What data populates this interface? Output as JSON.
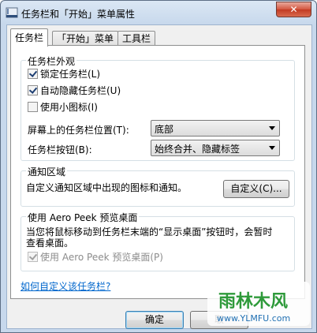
{
  "window": {
    "title": "任务栏和「开始」菜单属性",
    "close_label": "✕"
  },
  "tabs": [
    {
      "label": "任务栏",
      "active": true
    },
    {
      "label": "「开始」菜单",
      "active": false
    },
    {
      "label": "工具栏",
      "active": false
    }
  ],
  "appearance": {
    "title": "任务栏外观",
    "lock_taskbar": {
      "label": "锁定任务栏(L)",
      "checked": true
    },
    "auto_hide": {
      "label": "自动隐藏任务栏(U)",
      "checked": true
    },
    "small_icons": {
      "label": "使用小图标(I)",
      "checked": false
    },
    "location": {
      "label": "屏幕上的任务栏位置(T):",
      "value": "底部"
    },
    "buttons": {
      "label": "任务栏按钮(B):",
      "value": "始终合并、隐藏标签"
    }
  },
  "notification": {
    "title": "通知区域",
    "description": "自定义通知区域中出现的图标和通知。",
    "customize_label": "自定义(C)..."
  },
  "aero_peek": {
    "title": "使用 Aero Peek 预览桌面",
    "description_line1": "当您将鼠标移动到任务栏末端的“显示桌面”按钮时，会暂时",
    "description_line2": "查看桌面。",
    "checkbox": {
      "label": "使用 Aero Peek 预览桌面(P)",
      "checked": true
    }
  },
  "help_link": "如何自定义该任务栏?",
  "footer": {
    "ok_label": "确定",
    "cancel_label": "取"
  },
  "watermark": {
    "text": "雨林木风",
    "url": "www.YLMFU.com"
  }
}
